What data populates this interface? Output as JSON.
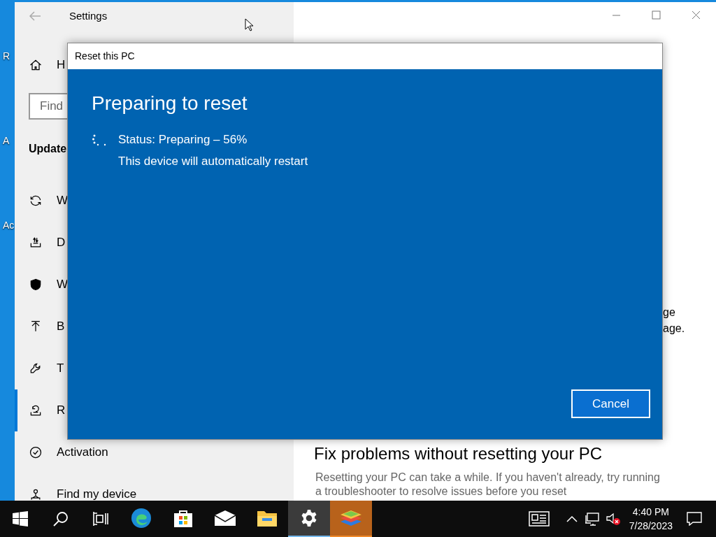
{
  "desktop": {
    "icon_labels": [
      "R",
      "A",
      "Ac"
    ]
  },
  "settings": {
    "title": "Settings",
    "search": {
      "placeholder": "Find"
    },
    "section": "Update",
    "nav_items": [
      {
        "label": "H",
        "selected": false
      },
      {
        "label": "W",
        "selected": false
      },
      {
        "label": "D",
        "selected": false
      },
      {
        "label": "W",
        "selected": false
      },
      {
        "label": "B",
        "selected": false
      },
      {
        "label": "T",
        "selected": false
      },
      {
        "label": "R",
        "selected": true
      },
      {
        "label": "Activation",
        "selected": false
      },
      {
        "label": "Find my device",
        "selected": false
      }
    ],
    "content": {
      "partial_lines": [
        "ge",
        "age."
      ],
      "heading": "Fix problems without resetting your PC",
      "paragraph": "Resetting your PC can take a while. If you haven't already, try running",
      "paragraph_cut": "a troubleshooter to resolve issues before you reset"
    }
  },
  "dialog": {
    "title": "Reset this PC",
    "heading": "Preparing to reset",
    "status": "Status: Preparing – 56%",
    "note": "This device will automatically restart",
    "button": "Cancel"
  },
  "taskbar": {
    "apps": [
      {
        "kind": "edge",
        "active": false,
        "flashing": false
      },
      {
        "kind": "store",
        "active": false,
        "flashing": false
      },
      {
        "kind": "mail",
        "active": false,
        "flashing": false
      },
      {
        "kind": "explorer",
        "active": false,
        "flashing": false
      },
      {
        "kind": "settings",
        "active": true,
        "flashing": false
      },
      {
        "kind": "stack",
        "active": false,
        "flashing": true
      }
    ],
    "time": "4:40 PM",
    "date": "7/28/2023",
    "volume_muted": true
  }
}
